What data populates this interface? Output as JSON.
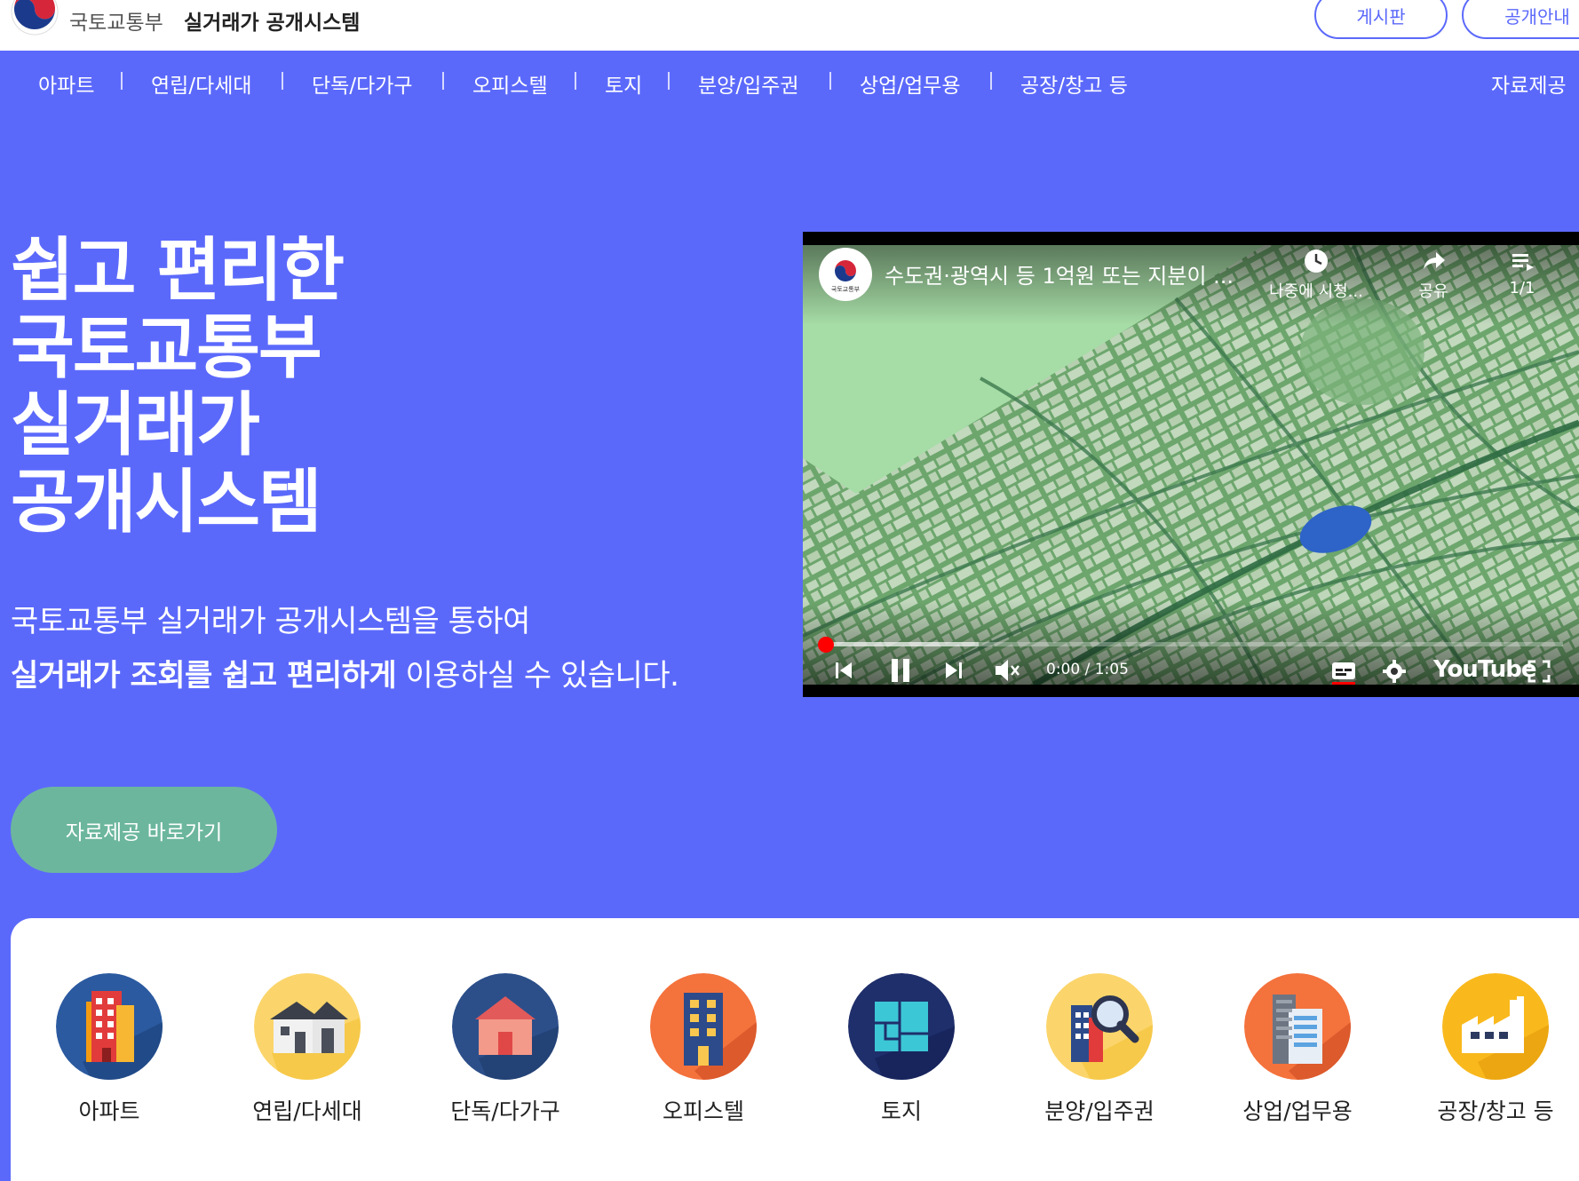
{
  "header": {
    "ministry": "국토교통부",
    "title": "실거래가 공개시스템",
    "board_button": "게시판",
    "guide_button": "공개안내"
  },
  "nav": {
    "items": [
      "아파트",
      "연립/다세대",
      "단독/다가구",
      "오피스텔",
      "토지",
      "분양/입주권",
      "상업/업무용",
      "공장/창고 등"
    ],
    "right": "자료제공"
  },
  "hero": {
    "title_lines": [
      "쉽고 편리한",
      "국토교통부",
      "실거래가",
      "공개시스템"
    ],
    "desc_line1": "국토교통부 실거래가 공개시스템을 통하여",
    "desc_line2_bold": "실거래가 조회를 쉽고 편리하게",
    "desc_line2_rest": " 이용하실 수 있습니다.",
    "cta": "자료제공 바로가기"
  },
  "video": {
    "title": "수도권·광역시 등 1억원 또는 지분이 ...",
    "channel_label": "국토교통부",
    "watch_later": "나중에 시청...",
    "share": "공유",
    "playlist": "1/1",
    "time": "0:00 / 1:05",
    "brand": "YouTube",
    "progress": 0.01
  },
  "categories": [
    {
      "label": "아파트",
      "icon": "apartment-icon"
    },
    {
      "label": "연립/다세대",
      "icon": "row-house-icon"
    },
    {
      "label": "단독/다가구",
      "icon": "detached-house-icon"
    },
    {
      "label": "오피스텔",
      "icon": "officetel-icon"
    },
    {
      "label": "토지",
      "icon": "land-icon"
    },
    {
      "label": "분양/입주권",
      "icon": "presale-icon"
    },
    {
      "label": "상업/업무용",
      "icon": "commercial-icon"
    },
    {
      "label": "공장/창고 등",
      "icon": "factory-icon"
    }
  ],
  "colors": {
    "primary": "#5b69fb",
    "cta": "#6cb69e"
  }
}
